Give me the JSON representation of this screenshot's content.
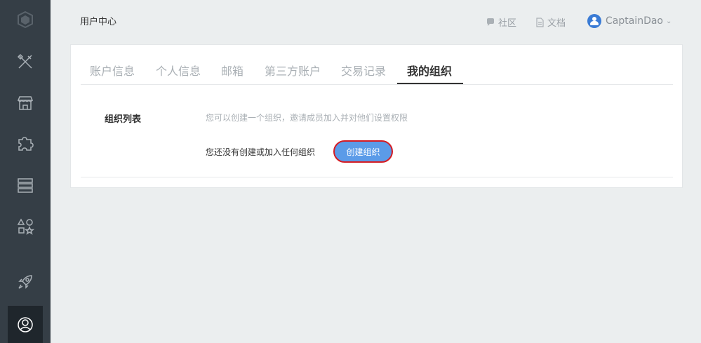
{
  "header": {
    "title": "用户中心",
    "community_label": "社区",
    "docs_label": "文档",
    "username": "CaptainDao"
  },
  "sidebar": {
    "items": [
      {
        "name": "logo"
      },
      {
        "name": "tools"
      },
      {
        "name": "store"
      },
      {
        "name": "plugins"
      },
      {
        "name": "servers"
      },
      {
        "name": "shapes"
      },
      {
        "name": "deploy"
      },
      {
        "name": "user-center",
        "active": true
      }
    ]
  },
  "tabs": [
    {
      "label": "账户信息"
    },
    {
      "label": "个人信息"
    },
    {
      "label": "邮箱"
    },
    {
      "label": "第三方账户"
    },
    {
      "label": "交易记录"
    },
    {
      "label": "我的组织",
      "active": true
    }
  ],
  "org": {
    "section_label": "组织列表",
    "description": "您可以创建一个组织，邀请成员加入并对他们设置权限",
    "empty_text": "您还没有创建或加入任何组织",
    "create_button": "创建组织"
  },
  "colors": {
    "sidebar_bg": "#353e46",
    "page_bg": "#ebeeef",
    "button_bg": "#5b9be8",
    "button_border": "#d51c24"
  }
}
